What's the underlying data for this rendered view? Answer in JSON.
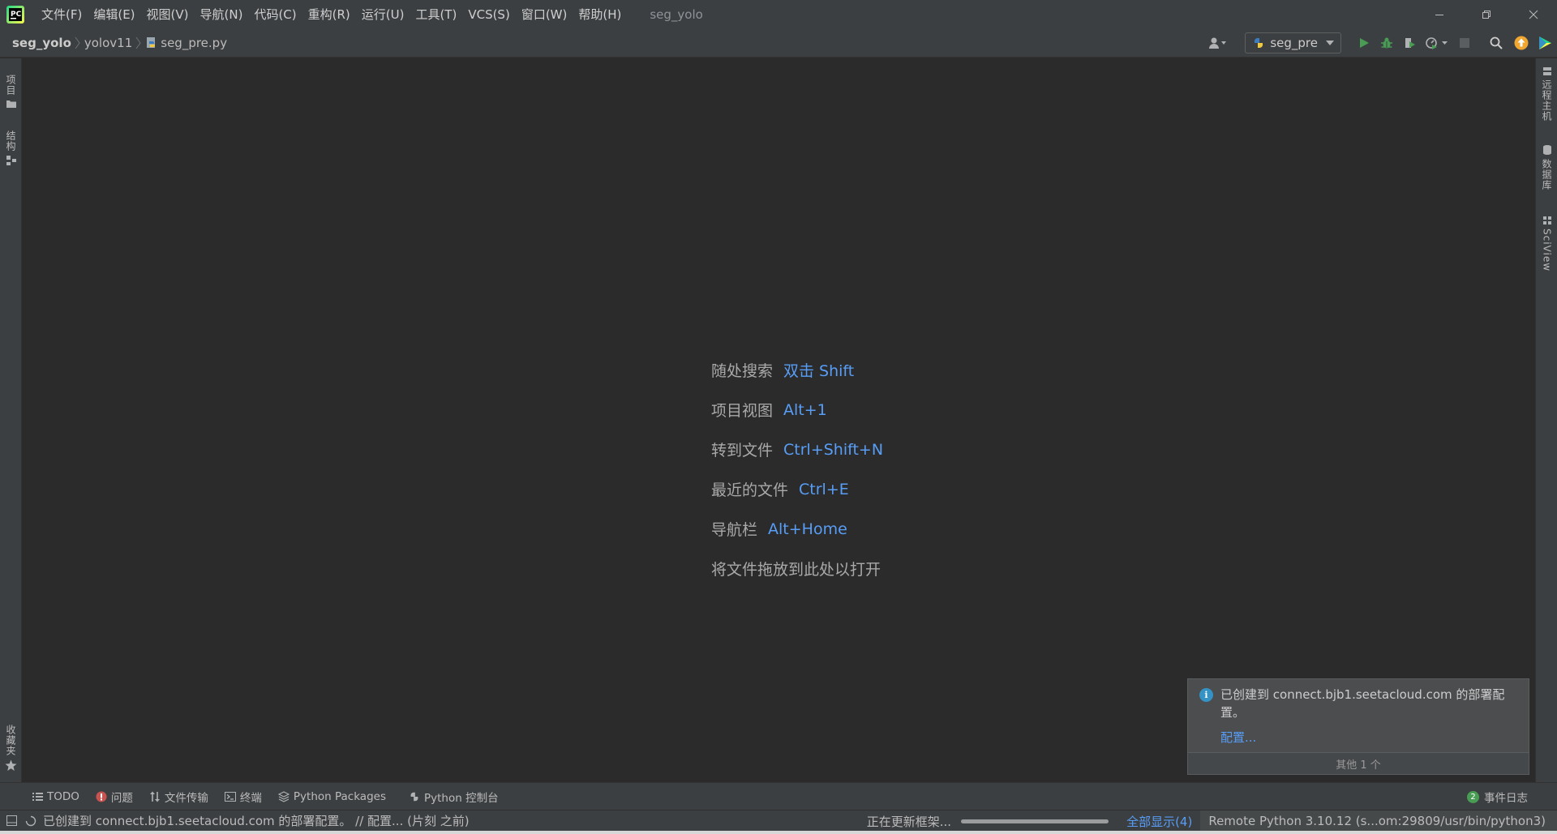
{
  "titlebar": {
    "menu": [
      "文件(F)",
      "编辑(E)",
      "视图(V)",
      "导航(N)",
      "代码(C)",
      "重构(R)",
      "运行(U)",
      "工具(T)",
      "VCS(S)",
      "窗口(W)",
      "帮助(H)"
    ],
    "app_title": "seg_yolo"
  },
  "navbar": {
    "breadcrumbs": [
      "seg_yolo",
      "yolov11",
      "seg_pre.py"
    ],
    "run_config": "seg_pre"
  },
  "left_strip": {
    "project": "项目",
    "structure": "结构",
    "favorites": "收藏夹"
  },
  "right_strip": {
    "remote_host": "远程主机",
    "database": "数据库",
    "sciview": "SciView"
  },
  "editor_hints": [
    {
      "label": "随处搜索",
      "key": "双击 Shift"
    },
    {
      "label": "项目视图",
      "key": "Alt+1"
    },
    {
      "label": "转到文件",
      "key": "Ctrl+Shift+N"
    },
    {
      "label": "最近的文件",
      "key": "Ctrl+E"
    },
    {
      "label": "导航栏",
      "key": "Alt+Home"
    },
    {
      "label": "将文件拖放到此处以打开",
      "key": ""
    }
  ],
  "notification": {
    "text": "已创建到 connect.bjb1.seetacloud.com 的部署配置。",
    "link": "配置...",
    "footer": "其他 1 个"
  },
  "toolwindows": {
    "todo": "TODO",
    "problems": "问题",
    "file_transfer": "文件传输",
    "terminal": "终端",
    "python_packages": "Python Packages",
    "python_console": "Python 控制台",
    "event_log": "事件日志",
    "event_count": "2"
  },
  "statusbar": {
    "message": "已创建到 connect.bjb1.seetacloud.com 的部署配置。 // 配置... (片刻 之前)",
    "progress_label": "正在更新框架...",
    "progress": 1.0,
    "show_all": "全部显示(4)",
    "interpreter": "Remote Python 3.10.12 (s...om:29809/usr/bin/python3)"
  },
  "colors": {
    "accent_link": "#589df6",
    "run_green": "#499c54",
    "update_orange": "#f0a732",
    "info_blue": "#3592c4"
  }
}
